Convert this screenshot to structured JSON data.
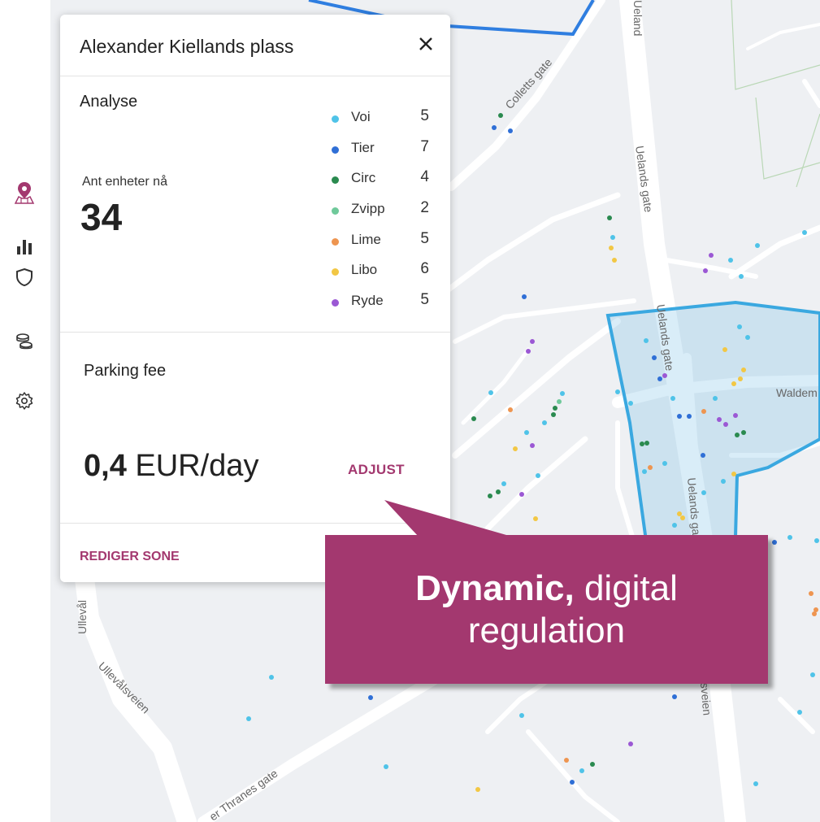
{
  "panel": {
    "title": "Alexander Kiellands plass",
    "close_icon": "close-icon",
    "analysis_title": "Analyse",
    "count_label": "Ant enheter nå",
    "count_value": "34",
    "operators": [
      {
        "name": "Voi",
        "count": "5",
        "color": "#4fc3e8"
      },
      {
        "name": "Tier",
        "count": "7",
        "color": "#2f6fd6"
      },
      {
        "name": "Circ",
        "count": "4",
        "color": "#2a8a4f"
      },
      {
        "name": "Zvipp",
        "count": "2",
        "color": "#6fc99a"
      },
      {
        "name": "Lime",
        "count": "5",
        "color": "#ee9550"
      },
      {
        "name": "Libo",
        "count": "6",
        "color": "#f2c744"
      },
      {
        "name": "Ryde",
        "count": "5",
        "color": "#9b58d4"
      }
    ],
    "fee_title": "Parking fee",
    "fee_amount": "0,4",
    "fee_unit": " EUR/day",
    "adjust_label": "ADJUST",
    "edit_label": "REDIGER SONE"
  },
  "callout": {
    "bold": "Dynamic,",
    "rest": " digital",
    "line2": "regulation",
    "color": "#a3386f"
  },
  "map": {
    "street_labels": [
      "Colletts gate",
      "Uelands gate",
      "Uelands gate",
      "Uelands gate",
      "Ueland",
      "Uelands",
      "Waldem",
      "Ullevålsveien",
      "Ullevålsveien",
      "Ullevål",
      "sveien",
      "er Thranes gate"
    ],
    "zone_color": "#3aa8e0"
  },
  "sidebar": {
    "icons": [
      "map-pin-icon",
      "bar-chart-icon",
      "shield-icon",
      "coins-icon",
      "settings-icon"
    ],
    "active_color": "#a3386f"
  }
}
